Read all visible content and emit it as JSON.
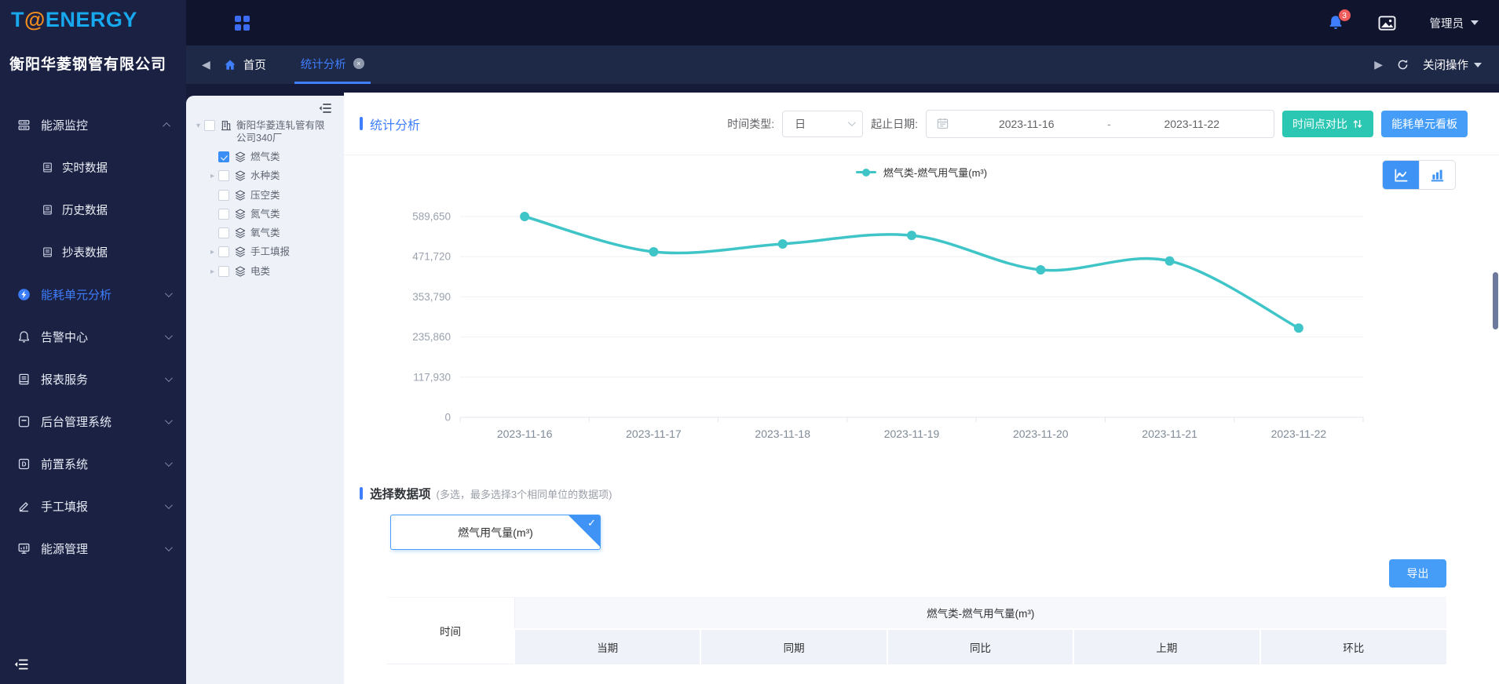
{
  "brand": {
    "logo_t": "T",
    "logo_at": "@",
    "logo_rest": "ENERGY",
    "company": "衡阳华菱钢管有限公司"
  },
  "header": {
    "badge_count": "3",
    "user_label": "管理员"
  },
  "tabbar": {
    "home_label": "首页",
    "tabs": [
      {
        "label": "统计分析",
        "active": true
      }
    ],
    "close_op_label": "关闭操作"
  },
  "sidebar": {
    "items": [
      {
        "label": "能源监控",
        "icon": "monitor-icon",
        "expanded": true,
        "active": false,
        "children": [
          {
            "label": "实时数据",
            "icon": "doc-icon"
          },
          {
            "label": "历史数据",
            "icon": "doc-icon"
          },
          {
            "label": "抄表数据",
            "icon": "doc-icon"
          }
        ]
      },
      {
        "label": "能耗单元分析",
        "icon": "bolt-icon",
        "active": true
      },
      {
        "label": "告警中心",
        "icon": "alarm-icon",
        "active": false
      },
      {
        "label": "报表服务",
        "icon": "report-icon",
        "active": false
      },
      {
        "label": "后台管理系统",
        "icon": "admin-icon",
        "active": false
      },
      {
        "label": "前置系统",
        "icon": "front-icon",
        "active": false
      },
      {
        "label": "手工填报",
        "icon": "pencil-icon",
        "active": false
      },
      {
        "label": "能源管理",
        "icon": "energy-icon",
        "active": false
      }
    ]
  },
  "tree": {
    "nodes": [
      {
        "label": "衡阳华菱连轧管有限公司340厂",
        "level": 0,
        "expander": "expanded",
        "checked": false,
        "icon": "building-icon"
      },
      {
        "label": "燃气类",
        "level": 1,
        "expander": "none",
        "checked": true,
        "icon": "layers-icon"
      },
      {
        "label": "水种类",
        "level": 1,
        "expander": "collapsed",
        "checked": false,
        "icon": "layers-icon"
      },
      {
        "label": "压空类",
        "level": 1,
        "expander": "none",
        "checked": false,
        "icon": "layers-icon"
      },
      {
        "label": "氮气类",
        "level": 1,
        "expander": "none",
        "checked": false,
        "icon": "layers-icon"
      },
      {
        "label": "氧气类",
        "level": 1,
        "expander": "none",
        "checked": false,
        "icon": "layers-icon"
      },
      {
        "label": "手工填报",
        "level": 1,
        "expander": "collapsed",
        "checked": false,
        "icon": "layers-icon"
      },
      {
        "label": "电类",
        "level": 1,
        "expander": "collapsed",
        "checked": false,
        "icon": "layers-icon"
      }
    ]
  },
  "main": {
    "title": "统计分析",
    "filters": {
      "time_type_label": "时间类型:",
      "time_type_value": "日",
      "date_range_label": "起止日期:",
      "date_start": "2023-11-16",
      "date_separator": "-",
      "date_end": "2023-11-22"
    },
    "actions": {
      "compare_label": "时间点对比",
      "board_label": "能耗单元看板"
    },
    "picker": {
      "title": "选择数据项",
      "hint": "(多选，最多选择3个相同单位的数据项)",
      "selected_item": "燃气用气量(m³)"
    },
    "export_label": "导出",
    "table": {
      "time_header": "时间",
      "group_header": "燃气类-燃气用气量(m³)",
      "sub_headers": [
        "当期",
        "同期",
        "同比",
        "上期",
        "环比"
      ]
    }
  },
  "chart_data": {
    "type": "line",
    "smooth": true,
    "grid": true,
    "legend_position": "top-center",
    "x": [
      "2023-11-16",
      "2023-11-17",
      "2023-11-18",
      "2023-11-19",
      "2023-11-20",
      "2023-11-21",
      "2023-11-22"
    ],
    "series": [
      {
        "name": "燃气类-燃气用气量(m³)",
        "color": "#3fc5c8",
        "values": [
          589650,
          486000,
          509000,
          534000,
          433000,
          459000,
          262000
        ]
      }
    ],
    "ylim": [
      0,
      589650
    ],
    "y_ticks": [
      0,
      117930,
      235860,
      353790,
      471720,
      589650
    ],
    "xlabel": "",
    "ylabel": ""
  },
  "colors": {
    "accent_blue": "#3f7efc",
    "series_teal": "#3fc5c8",
    "button_teal": "#2cc7b2",
    "button_blue": "#459df8",
    "badge_red": "#f05b5b",
    "sidebar_bg": "#1a2142",
    "topbar_bg": "#10142c",
    "tabbar_bg": "#1e2847",
    "tree_panel_bg": "#eef2f8"
  },
  "icons": {
    "apps-grid-icon": "2x2 grid of squares",
    "notification-bell-icon": "filled bell with count badge",
    "picture-icon": "image with mountain",
    "home-icon": "house",
    "back-icon": "left triangle",
    "forward-icon": "right triangle",
    "refresh-icon": "circular arrow",
    "close-icon": "x in circle",
    "monitor-icon": "server stack",
    "doc-icon": "document book",
    "bolt-icon": "lightning in blue circle",
    "alarm-icon": "bell outline",
    "report-icon": "document book",
    "admin-icon": "rounded box with slot",
    "front-icon": "boxed letter D",
    "pencil-icon": "pencil over line",
    "energy-icon": "monitor with bars",
    "building-icon": "office building",
    "layers-icon": "stacked layers",
    "fold-panel-icon": "three lines with left arrow",
    "calendar-icon": "calendar",
    "line-chart-icon": "line chart with points",
    "bar-chart-icon": "three bars",
    "sort-arrows-icon": "up and down arrows",
    "check-icon": "checkmark",
    "chevron-down-icon": "chevron down",
    "chevron-up-icon": "chevron up"
  }
}
